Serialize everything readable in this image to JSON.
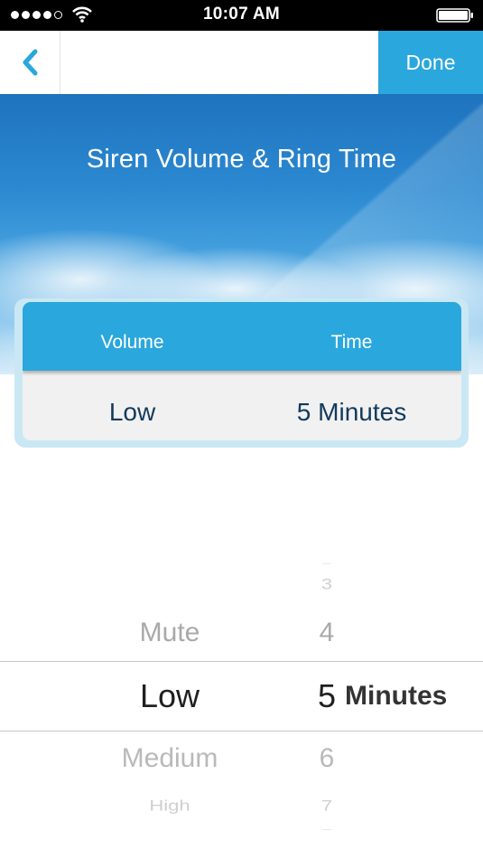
{
  "status_bar": {
    "time": "10:07 AM",
    "signal_bars": 4,
    "signal_max": 5
  },
  "nav": {
    "back_icon": "chevron-left-icon",
    "done_label": "Done"
  },
  "header": {
    "title": "Siren Volume & Ring Time"
  },
  "summary": {
    "columns": [
      "Volume",
      "Time"
    ],
    "values": [
      "Low",
      "5 Minutes"
    ]
  },
  "picker": {
    "volume_options": [
      "Mute",
      "Low",
      "Medium",
      "High"
    ],
    "volume_selected": "Low",
    "minutes_visible": [
      "3",
      "4",
      "5",
      "6",
      "7"
    ],
    "minutes_selected": "5",
    "minutes_unit": "Minutes"
  },
  "colors": {
    "accent": "#2aa7dc",
    "card_text": "#123a5c",
    "sky_top": "#1e73bd"
  }
}
